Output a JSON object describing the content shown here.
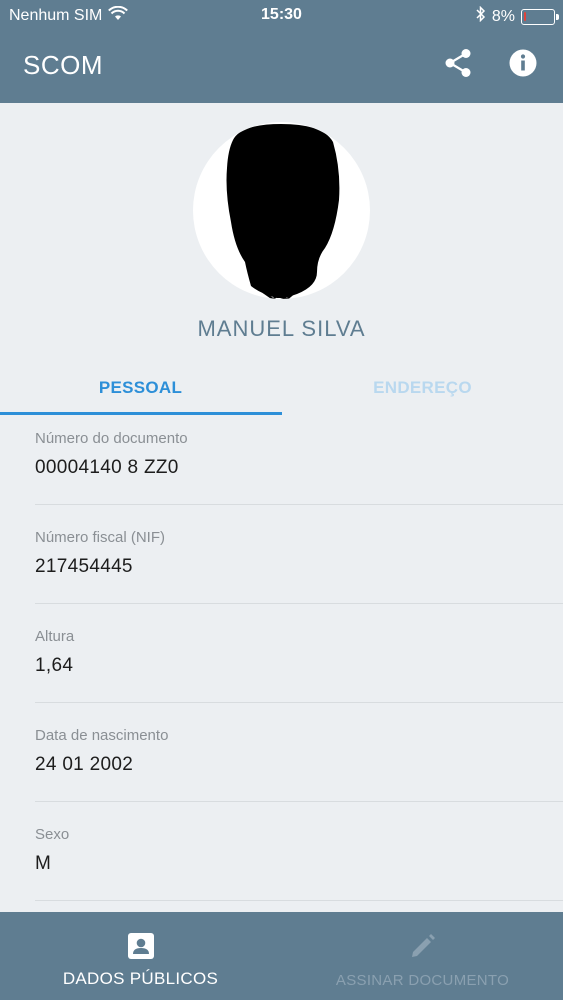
{
  "status_bar": {
    "carrier": "Nenhum SIM",
    "time": "15:30",
    "battery": "8%",
    "battery_level": 0.08,
    "icons": [
      "wifi-icon",
      "bluetooth-icon",
      "battery-icon"
    ]
  },
  "app_bar": {
    "title": "SCOM",
    "actions": [
      "share-icon",
      "info-icon"
    ]
  },
  "profile": {
    "name": "MANUEL SILVA"
  },
  "tabs": [
    {
      "label": "PESSOAL",
      "active": true
    },
    {
      "label": "ENDEREÇO",
      "active": false
    }
  ],
  "fields": [
    {
      "label": "Número do documento",
      "value": "00004140 8 ZZ0"
    },
    {
      "label": "Número fiscal (NIF)",
      "value": "217454445"
    },
    {
      "label": "Altura",
      "value": "1,64"
    },
    {
      "label": "Data de nascimento",
      "value": "24 01 2002"
    },
    {
      "label": "Sexo",
      "value": "M"
    }
  ],
  "bottom_nav": [
    {
      "label": "DADOS PÚBLICOS",
      "icon": "id-card-icon",
      "active": true
    },
    {
      "label": "ASSINAR DOCUMENTO",
      "icon": "pencil-icon",
      "active": false
    }
  ],
  "colors": {
    "primary": "#5f7d91",
    "accent": "#2d8fd8",
    "background": "#eceff2"
  }
}
